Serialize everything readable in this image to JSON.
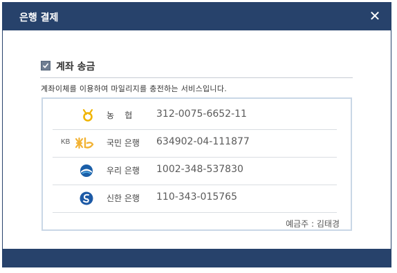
{
  "dialog": {
    "title": "은행 결제",
    "close_label": "✕"
  },
  "section": {
    "title": "계좌 송금",
    "description": "계좌이체를 이용하여 마일리지를 충전하는 서비스입니다."
  },
  "accounts": [
    {
      "bank": "농    협",
      "number": "312-0075-6652-11",
      "logo_text": ""
    },
    {
      "bank": "국민 은행",
      "number": "634902-04-111877",
      "logo_text": "KB"
    },
    {
      "bank": "우리 은행",
      "number": "1002-348-537830",
      "logo_text": ""
    },
    {
      "bank": "신한 은행",
      "number": "110-343-015765",
      "logo_text": ""
    }
  ],
  "holder": "예금주 : 김태경",
  "colors": {
    "titlebar": "#27426b",
    "nh": "#f0b400",
    "kb": "#f2b233",
    "woori": "#1b5fa8",
    "shinhan": "#1d5aa6"
  }
}
